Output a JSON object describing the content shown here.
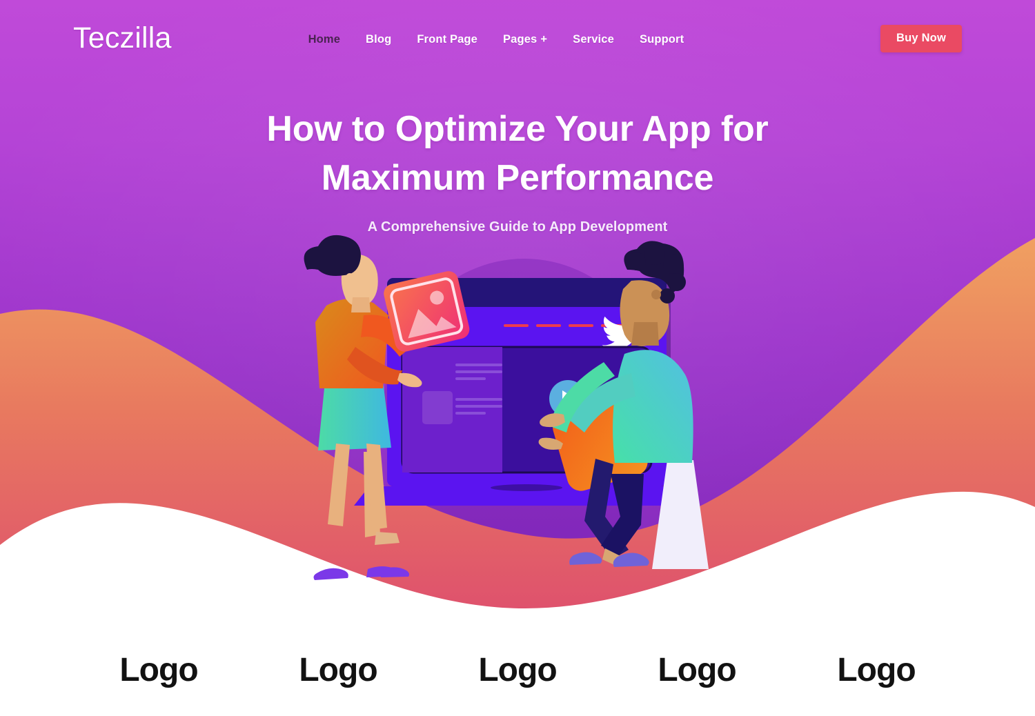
{
  "brand": {
    "name": "Teczilla"
  },
  "nav": {
    "items": [
      {
        "label": "Home",
        "active": true,
        "icon": ""
      },
      {
        "label": "Blog",
        "active": false,
        "icon": ""
      },
      {
        "label": "Front Page",
        "active": false,
        "icon": ""
      },
      {
        "label": "Pages",
        "active": false,
        "icon": "plus-icon",
        "suffix": "+"
      },
      {
        "label": "Service",
        "active": false,
        "icon": ""
      },
      {
        "label": "Support",
        "active": false,
        "icon": ""
      }
    ],
    "cta": {
      "label": "Buy Now"
    }
  },
  "hero": {
    "title": "How to Optimize Your App for Maximum Performance",
    "title_line1": "How to Optimize Your App for",
    "title_line2": "Maximum Performance",
    "subtitle": "A Comprehensive Guide to App Development"
  },
  "illustration": {
    "alt": "Two people assembling media cards on a large browser window",
    "browser": {
      "dots": 3,
      "pill_label": "",
      "dashes": 4,
      "social_icon": "twitter-bird-icon",
      "play_icon": "play-button-icon"
    },
    "cards": [
      {
        "name": "image-card",
        "icon": "image-placeholder-icon"
      },
      {
        "name": "video-card",
        "icon": ""
      }
    ]
  },
  "logos": {
    "items": [
      {
        "label": "Logo"
      },
      {
        "label": "Logo"
      },
      {
        "label": "Logo"
      },
      {
        "label": "Logo"
      },
      {
        "label": "Logo"
      }
    ]
  },
  "colors": {
    "hero_top": "#c04ad9",
    "hero_bottom": "#8a2bc0",
    "wave_orange": "#ef9359",
    "wave_pink": "#e2566c",
    "cta": "#ea4a63",
    "nav_active": "#4a2352",
    "screen_purple": "#5b14f0",
    "screen_dark": "#241478",
    "card_orange": "#f2701f",
    "card_pink": "#f0407d",
    "play_blue": "#5bafe0",
    "accent_teal": "#4ad9c0",
    "logo_text": "#121212"
  }
}
